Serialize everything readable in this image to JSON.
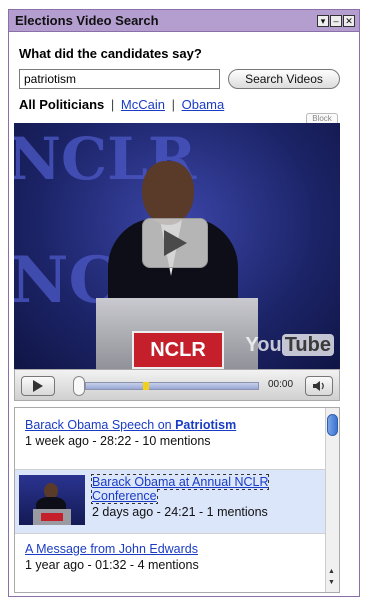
{
  "window": {
    "title": "Elections Video Search",
    "controls": [
      "menu-icon",
      "minimize-icon",
      "close-icon"
    ]
  },
  "search": {
    "question": "What did the candidates say?",
    "query": "patriotism",
    "button_label": "Search Videos"
  },
  "filters": {
    "active": "All Politicians",
    "links": [
      "McCain",
      "Obama"
    ]
  },
  "player": {
    "block_label": "Block",
    "time": "00:00",
    "logo_you": "You",
    "logo_tube": "Tube",
    "podium_sign": "NCLR",
    "background_letters": [
      "NCLR",
      "NCLR"
    ]
  },
  "results": [
    {
      "title_prefix": "Barack Obama Speech on ",
      "title_highlight": "Patriotism",
      "meta": "1 week ago - 28:22 - 10 mentions"
    },
    {
      "title": "Barack Obama at Annual NCLR Conference",
      "meta": "2 days ago - 24:21 - 1 mentions",
      "selected": true
    },
    {
      "title": "A Message from John Edwards",
      "meta": "1 year ago - 01:32 - 4 mentions"
    }
  ]
}
